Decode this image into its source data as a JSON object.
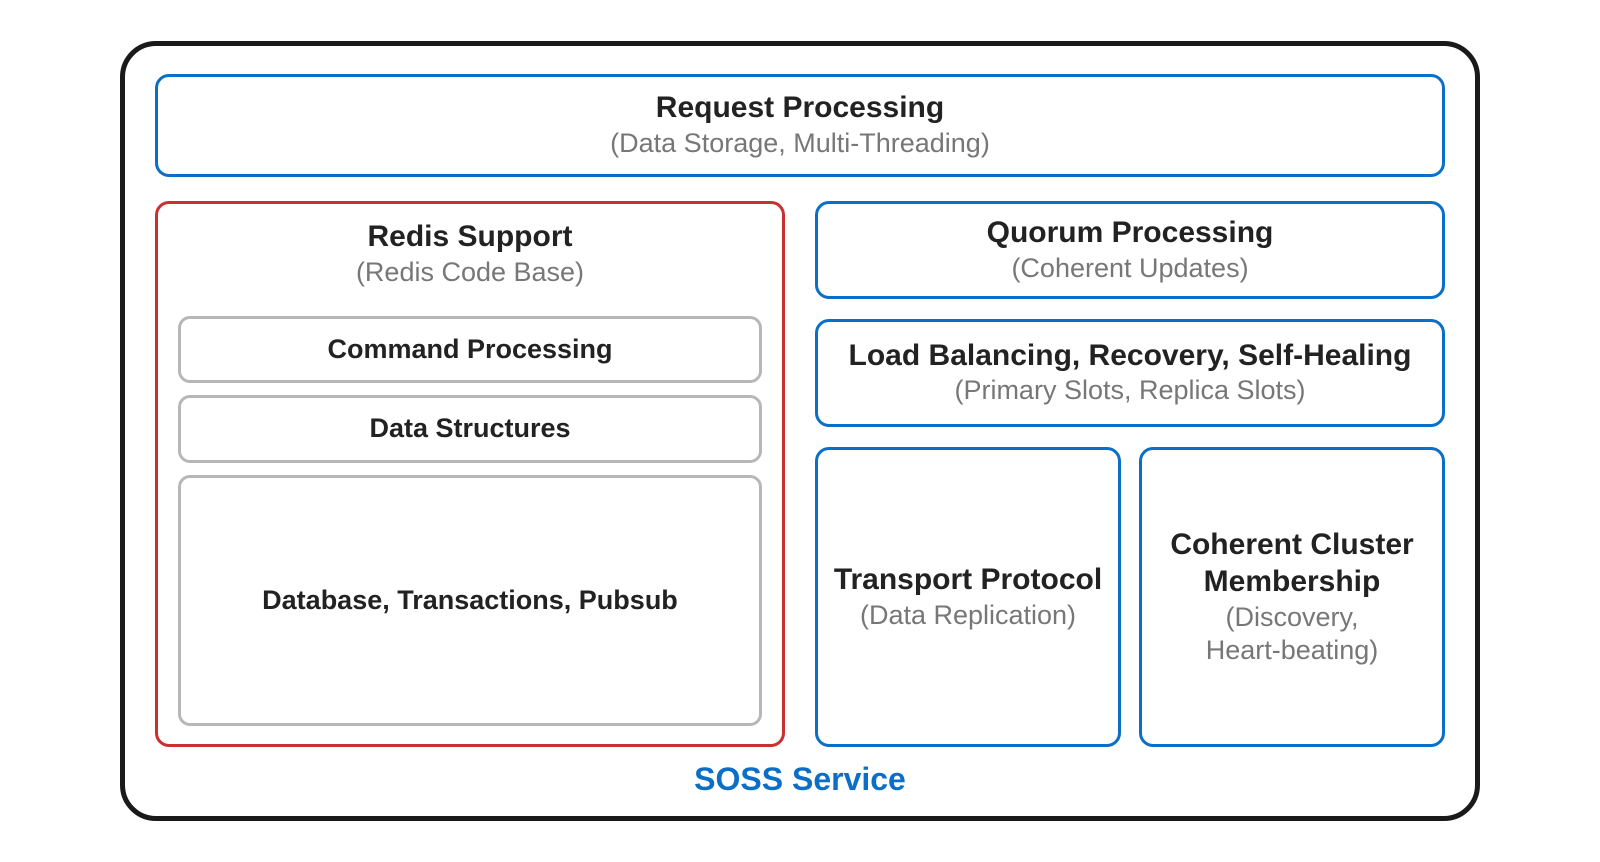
{
  "footer_label": "SOSS Service",
  "top": {
    "title": "Request Processing",
    "subtitle": "(Data Storage, Multi-Threading)"
  },
  "redis": {
    "title": "Redis Support",
    "subtitle": "(Redis Code Base)",
    "items": [
      "Command Processing",
      "Data Structures",
      "Database, Transactions, Pubsub"
    ]
  },
  "right": {
    "quorum": {
      "title": "Quorum Processing",
      "subtitle": "(Coherent Updates)"
    },
    "loadbal": {
      "title": "Load Balancing, Recovery, Self-Healing",
      "subtitle": "(Primary Slots, Replica Slots)"
    },
    "transport": {
      "title": "Transport Protocol",
      "subtitle_a": "(Data Replication)"
    },
    "membership": {
      "title": "Coherent Cluster Membership",
      "subtitle_a": "(Discovery,",
      "subtitle_b": "Heart-beating)"
    }
  },
  "colors": {
    "blue": "#0b6fc7",
    "red": "#cc2f2f",
    "gray": "#b7b7b7",
    "text_dark": "#222",
    "text_muted": "#777"
  }
}
